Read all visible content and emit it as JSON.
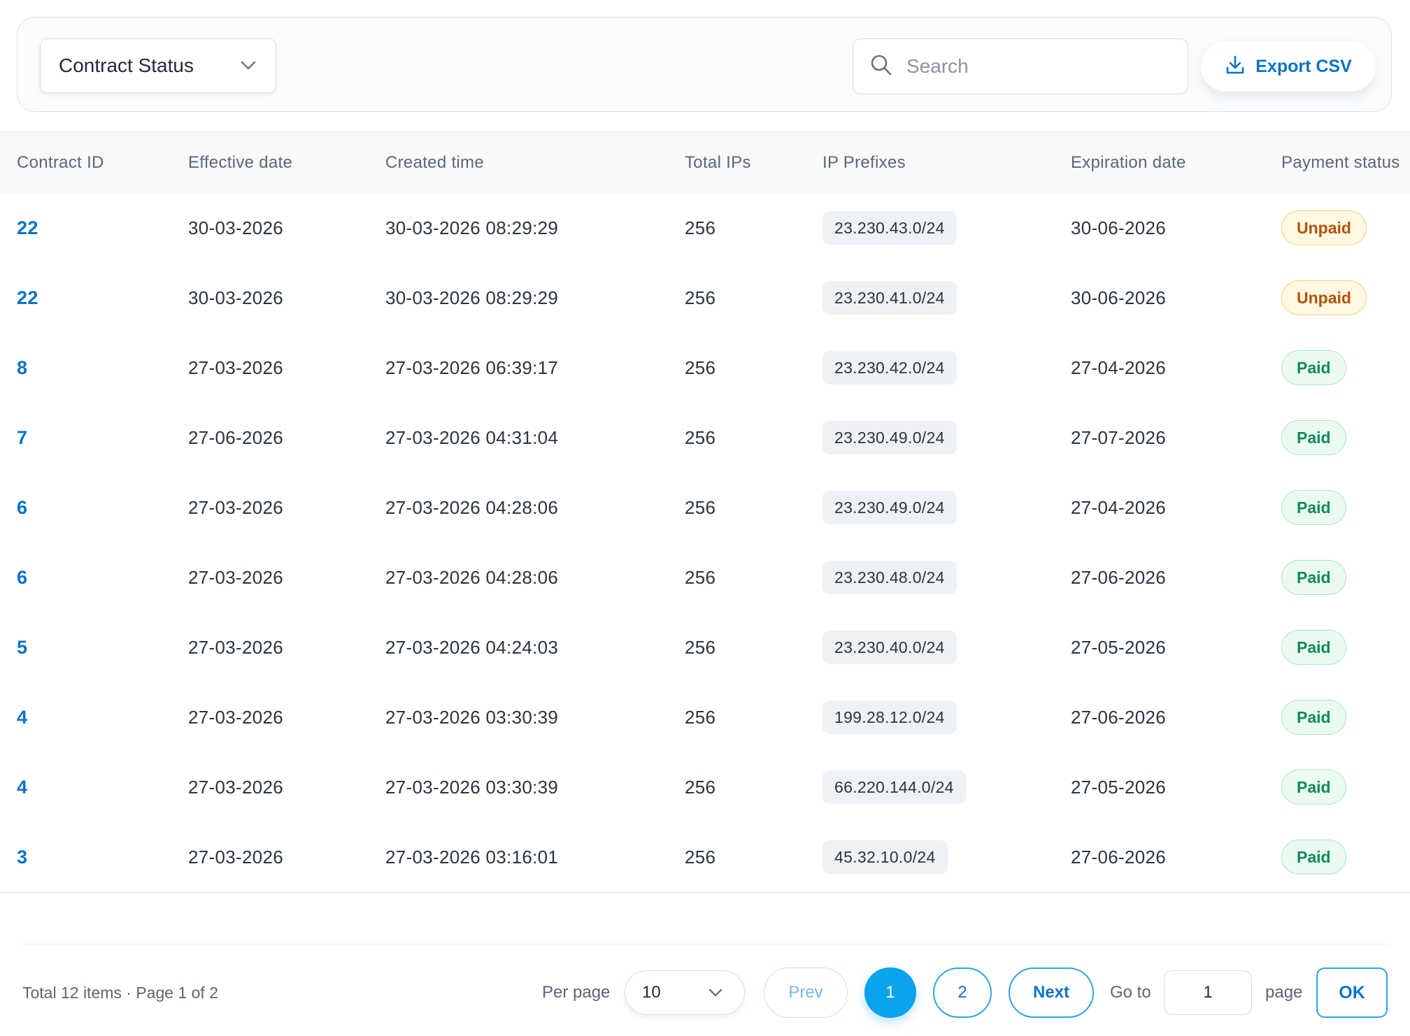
{
  "filters": {
    "contract_status_label": "Contract Status",
    "search_placeholder": "Search",
    "export_label": "Export CSV"
  },
  "table": {
    "columns": [
      "Contract ID",
      "Effective date",
      "Created time",
      "Total IPs",
      "IP Prefixes",
      "Expiration date",
      "Payment status"
    ],
    "rows": [
      {
        "id": "22",
        "effective": "30-03-2026",
        "created": "30-03-2026 08:29:29",
        "total_ips": "256",
        "prefix": "23.230.43.0/24",
        "expiration": "30-06-2026",
        "status": "Unpaid"
      },
      {
        "id": "22",
        "effective": "30-03-2026",
        "created": "30-03-2026 08:29:29",
        "total_ips": "256",
        "prefix": "23.230.41.0/24",
        "expiration": "30-06-2026",
        "status": "Unpaid"
      },
      {
        "id": "8",
        "effective": "27-03-2026",
        "created": "27-03-2026 06:39:17",
        "total_ips": "256",
        "prefix": "23.230.42.0/24",
        "expiration": "27-04-2026",
        "status": "Paid"
      },
      {
        "id": "7",
        "effective": "27-06-2026",
        "created": "27-03-2026 04:31:04",
        "total_ips": "256",
        "prefix": "23.230.49.0/24",
        "expiration": "27-07-2026",
        "status": "Paid"
      },
      {
        "id": "6",
        "effective": "27-03-2026",
        "created": "27-03-2026 04:28:06",
        "total_ips": "256",
        "prefix": "23.230.49.0/24",
        "expiration": "27-04-2026",
        "status": "Paid"
      },
      {
        "id": "6",
        "effective": "27-03-2026",
        "created": "27-03-2026 04:28:06",
        "total_ips": "256",
        "prefix": "23.230.48.0/24",
        "expiration": "27-06-2026",
        "status": "Paid"
      },
      {
        "id": "5",
        "effective": "27-03-2026",
        "created": "27-03-2026 04:24:03",
        "total_ips": "256",
        "prefix": "23.230.40.0/24",
        "expiration": "27-05-2026",
        "status": "Paid"
      },
      {
        "id": "4",
        "effective": "27-03-2026",
        "created": "27-03-2026 03:30:39",
        "total_ips": "256",
        "prefix": "199.28.12.0/24",
        "expiration": "27-06-2026",
        "status": "Paid"
      },
      {
        "id": "4",
        "effective": "27-03-2026",
        "created": "27-03-2026 03:30:39",
        "total_ips": "256",
        "prefix": "66.220.144.0/24",
        "expiration": "27-05-2026",
        "status": "Paid"
      },
      {
        "id": "3",
        "effective": "27-03-2026",
        "created": "27-03-2026 03:16:01",
        "total_ips": "256",
        "prefix": "45.32.10.0/24",
        "expiration": "27-06-2026",
        "status": "Paid"
      }
    ]
  },
  "pagination": {
    "summary": "Total 12 items · Page 1 of 2",
    "per_page_label": "Per page",
    "per_page_value": "10",
    "prev_label": "Prev",
    "pages": [
      "1",
      "2"
    ],
    "current_page": "1",
    "next_label": "Next",
    "goto_label": "Go to",
    "goto_value": "1",
    "page_label": "page",
    "ok_label": "OK"
  },
  "colors": {
    "accent": "#0a73c9",
    "active_page": "#0aa3ec",
    "paid": "#0f8a5f",
    "unpaid": "#b45309"
  },
  "icons": {
    "status_dropdown": "chevron-down-icon",
    "search": "search-icon",
    "export": "download-icon",
    "per_page_dropdown": "chevron-down-icon"
  }
}
